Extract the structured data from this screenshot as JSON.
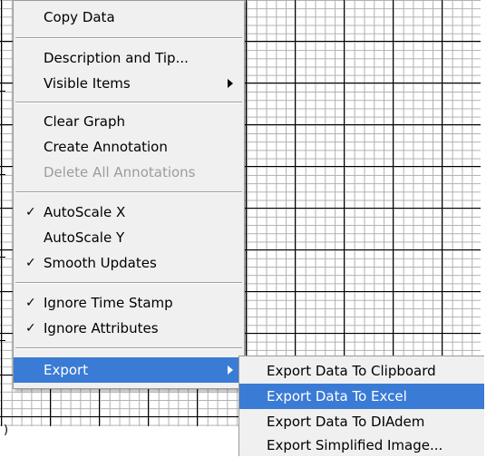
{
  "context_menu": {
    "items": [
      {
        "label": "Copy Data",
        "checked": false,
        "disabled": false
      },
      {
        "label": "Description and Tip...",
        "checked": false,
        "disabled": false
      },
      {
        "label": "Visible Items",
        "checked": false,
        "disabled": false,
        "has_submenu": true
      },
      {
        "label": "Clear Graph",
        "checked": false,
        "disabled": false
      },
      {
        "label": "Create Annotation",
        "checked": false,
        "disabled": false
      },
      {
        "label": "Delete All Annotations",
        "checked": false,
        "disabled": true
      },
      {
        "label": "AutoScale X",
        "checked": true,
        "disabled": false
      },
      {
        "label": "AutoScale Y",
        "checked": false,
        "disabled": false
      },
      {
        "label": "Smooth Updates",
        "checked": true,
        "disabled": false
      },
      {
        "label": "Ignore Time Stamp",
        "checked": true,
        "disabled": false
      },
      {
        "label": "Ignore Attributes",
        "checked": true,
        "disabled": false
      },
      {
        "label": "Export",
        "checked": false,
        "disabled": false,
        "has_submenu": true,
        "highlighted": true
      }
    ],
    "check_glyph": "✓"
  },
  "export_submenu": {
    "items": [
      {
        "label": "Export Data To Clipboard",
        "highlighted": false
      },
      {
        "label": "Export Data To Excel",
        "highlighted": true
      },
      {
        "label": "Export Data To DIAdem",
        "highlighted": false
      },
      {
        "label": "Export Simplified Image...",
        "highlighted": false
      }
    ]
  },
  "graph": {
    "partial_label": ")"
  },
  "figure_id": "14981-051",
  "colors": {
    "menu_bg": "#f0f0f0",
    "highlight": "#3a7bd5",
    "disabled_text": "#9c9c9c",
    "grid_major": "#000000",
    "grid_minor": "#b0b0b0"
  }
}
